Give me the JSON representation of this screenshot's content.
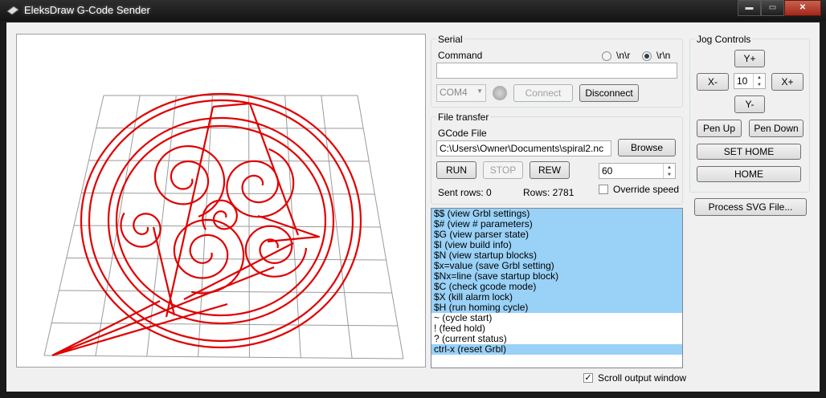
{
  "window": {
    "title": "EleksDraw G-Code Sender",
    "minimize": "▬",
    "maximize": "▭",
    "close": "✕"
  },
  "serial": {
    "group_label": "Serial",
    "command_label": "Command",
    "command_value": "",
    "line_ending_options": [
      "\\n\\r",
      "\\r\\n"
    ],
    "line_ending_selected": "\\r\\n",
    "port": "COM4",
    "connect_label": "Connect",
    "disconnect_label": "Disconnect"
  },
  "file_transfer": {
    "group_label": "File transfer",
    "gcode_label": "GCode File",
    "file_path": "C:\\Users\\Owner\\Documents\\spiral2.nc",
    "browse_label": "Browse",
    "run_label": "RUN",
    "stop_label": "STOP",
    "rew_label": "REW",
    "speed_value": "60",
    "override_label": "Override speed",
    "override_checked": false,
    "sent_rows": "Sent rows: 0",
    "rows": "Rows: 2781"
  },
  "jog": {
    "group_label": "Jog Controls",
    "y_plus": "Y+",
    "y_minus": "Y-",
    "x_minus": "X-",
    "x_plus": "X+",
    "step": "10",
    "pen_up": "Pen Up",
    "pen_down": "Pen Down",
    "set_home": "SET HOME",
    "home": "HOME"
  },
  "process_svg_label": "Process SVG File...",
  "output_lines": [
    {
      "text": "$$ (view Grbl settings)",
      "selected": true
    },
    {
      "text": "$# (view # parameters)",
      "selected": true
    },
    {
      "text": "$G (view parser state)",
      "selected": true
    },
    {
      "text": "$I (view build info)",
      "selected": true
    },
    {
      "text": "$N (view startup blocks)",
      "selected": true
    },
    {
      "text": "$x=value (save Grbl setting)",
      "selected": true
    },
    {
      "text": "$Nx=line (save startup block)",
      "selected": true
    },
    {
      "text": "$C (check gcode mode)",
      "selected": true
    },
    {
      "text": "$X (kill alarm lock)",
      "selected": true
    },
    {
      "text": "$H (run homing cycle)",
      "selected": true
    },
    {
      "text": "~ (cycle start)",
      "selected": false
    },
    {
      "text": "! (feed hold)",
      "selected": false
    },
    {
      "text": "? (current status)",
      "selected": false
    },
    {
      "text": "ctrl-x (reset Grbl)",
      "selected": true
    }
  ],
  "scroll_output_label": "Scroll output window",
  "scroll_output_checked": true,
  "colors": {
    "toolpath": "#e00000",
    "grid": "#9a9a9a",
    "selection": "#99d1f7"
  }
}
